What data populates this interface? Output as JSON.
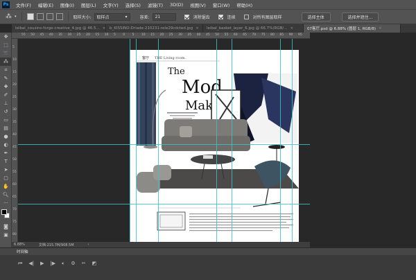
{
  "menubar": {
    "logo": "Ps",
    "items": [
      "文件(F)",
      "编辑(E)",
      "图像(I)",
      "图层(L)",
      "文字(Y)",
      "选择(S)",
      "滤镜(T)",
      "3D(D)",
      "视图(V)",
      "窗口(W)",
      "帮助(H)"
    ]
  },
  "options": {
    "sample_size_label": "取样大小:",
    "sample_size_value": "取样点",
    "tolerance_label": "容差:",
    "tolerance_value": "21",
    "antialias_label": "消除锯齿",
    "contiguous_label": "连续",
    "all_layers_label": "对所有图层取样",
    "select_subject": "选择主体",
    "select_and_mask": "选择并遮住..."
  },
  "tabs": [
    {
      "label": "leibal_cousins-forge-creative_4.jpg @ 46.5...",
      "active": false
    },
    {
      "label": "b_KISSINO-Driade-210231-rele29cdcted.jpg",
      "active": false
    },
    {
      "label": "leibal_basket_layer_6.jpg @ 66.7%(RGB/...",
      "active": false
    },
    {
      "label": "07客厅.psd @ 6.88% (图层 1, RGB/8)",
      "active": true
    }
  ],
  "ruler_top": [
    "55",
    "50",
    "45",
    "40",
    "35",
    "30",
    "25",
    "20",
    "15",
    "10",
    "5",
    "0",
    "5",
    "10",
    "15",
    "20",
    "25",
    "30",
    "35",
    "40",
    "45",
    "50",
    "55",
    "60",
    "65",
    "70",
    "75",
    "80",
    "85",
    "90",
    "95"
  ],
  "ruler_left": [
    "5",
    "10",
    "15",
    "20",
    "25",
    "30",
    "35",
    "40",
    "45",
    "50",
    "55",
    "60",
    "65",
    "70",
    "75",
    "80"
  ],
  "document": {
    "header_cn": "客厅",
    "header_en": "THE Living room.",
    "title_1": "The",
    "title_2": "Mod",
    "title_3": "Maker"
  },
  "status": {
    "zoom": "6.88%",
    "doc_size": "文档:215.7M/908.5M"
  },
  "timeline": {
    "label": "时间轴"
  },
  "colors": {
    "guide": "#3fc0c8",
    "ps_blue": "#31a8ff"
  }
}
